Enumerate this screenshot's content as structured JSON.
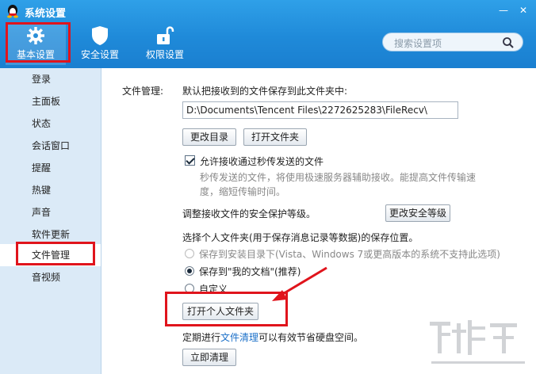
{
  "window": {
    "title": "系统设置",
    "minimize": "—",
    "close": "✕"
  },
  "tabs": [
    {
      "label": "基本设置",
      "icon": "gear-icon",
      "active": true
    },
    {
      "label": "安全设置",
      "icon": "shield-icon",
      "active": false
    },
    {
      "label": "权限设置",
      "icon": "lock-icon",
      "active": false
    }
  ],
  "search": {
    "placeholder": "搜索设置项",
    "icon": "search-icon"
  },
  "sidebar": {
    "items": [
      {
        "label": "登录"
      },
      {
        "label": "主面板"
      },
      {
        "label": "状态"
      },
      {
        "label": "会话窗口"
      },
      {
        "label": "提醒"
      },
      {
        "label": "热键"
      },
      {
        "label": "声音"
      },
      {
        "label": "软件更新"
      },
      {
        "label": "文件管理",
        "active": true
      },
      {
        "label": "音视频"
      }
    ]
  },
  "file_management": {
    "section_label": "文件管理:",
    "save_desc": "默认把接收到的文件保存到此文件夹中:",
    "path_value": "D:\\Documents\\Tencent Files\\2272625283\\FileRecv\\",
    "change_dir_button": "更改目录",
    "open_folder_button": "打开文件夹",
    "instant_transfer_label": "允许接收通过秒传发送的文件",
    "instant_transfer_checked": true,
    "instant_transfer_note_1": "秒传发送的文件，将使用极速服务器辅助接收。能提高文件传输速",
    "instant_transfer_note_2": "度，缩短传输时间。",
    "security_level_label": "调整接收文件的安全保护等级。",
    "change_security_button": "更改安全等级",
    "personal_folder_label": "选择个人文件夹(用于保存消息记录等数据)的保存位置。",
    "options": [
      {
        "label": "保存到安装目录下(Vista、Windows 7或更高版本的系统不支持此选项)",
        "selected": false,
        "disabled": true
      },
      {
        "label": "保存到\"我的文档\"(推荐)",
        "selected": true,
        "disabled": false
      },
      {
        "label": "自定义",
        "selected": false,
        "disabled": false
      }
    ],
    "open_personal_folder_button": "打开个人文件夹",
    "cleanup_prefix": "定期进行",
    "cleanup_link": "文件清理",
    "cleanup_suffix": "可以有效节省硬盘空间。",
    "cleanup_button": "立即清理"
  },
  "colors": {
    "header": "#1f8ad9",
    "sidebar": "#dbeaf7",
    "highlight": "#e0141c",
    "link": "#1a6fc8"
  }
}
